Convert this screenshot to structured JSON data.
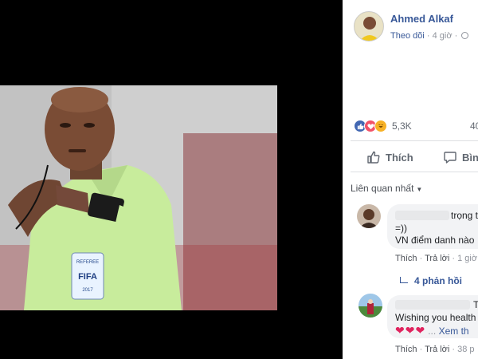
{
  "photo": {
    "alt": "Referee FIFA",
    "badge_top": "REFEREE",
    "badge_main": "FIFA",
    "badge_year": "2017"
  },
  "post": {
    "author": "Ahmed Alkaf",
    "follow_label": "Theo dõi",
    "time": "4 giờ",
    "reaction_count": "5,3K",
    "comment_count": "40"
  },
  "actions": {
    "like_label": "Thích",
    "comment_label": "Bình luận"
  },
  "comments_sort": "Liên quan nhất",
  "comments": [
    {
      "name_tail": "trọng t",
      "text_line1": "=))",
      "text_line2": "VN điểm danh nào",
      "like_label": "Thích",
      "reply_label": "Trả lời",
      "time": "1 giờ",
      "replies_label": "4 phản hồi"
    },
    {
      "name_tail": "T",
      "text_line1": "Wishing you health",
      "more_prefix": "...",
      "more_label": "Xem th",
      "like_label": "Thích",
      "reply_label": "Trả lời",
      "time": "38 p"
    }
  ],
  "colors": {
    "link": "#385898",
    "like_blue": "#4267b2",
    "love_red": "#f25268",
    "haha_yellow": "#f7b125"
  }
}
